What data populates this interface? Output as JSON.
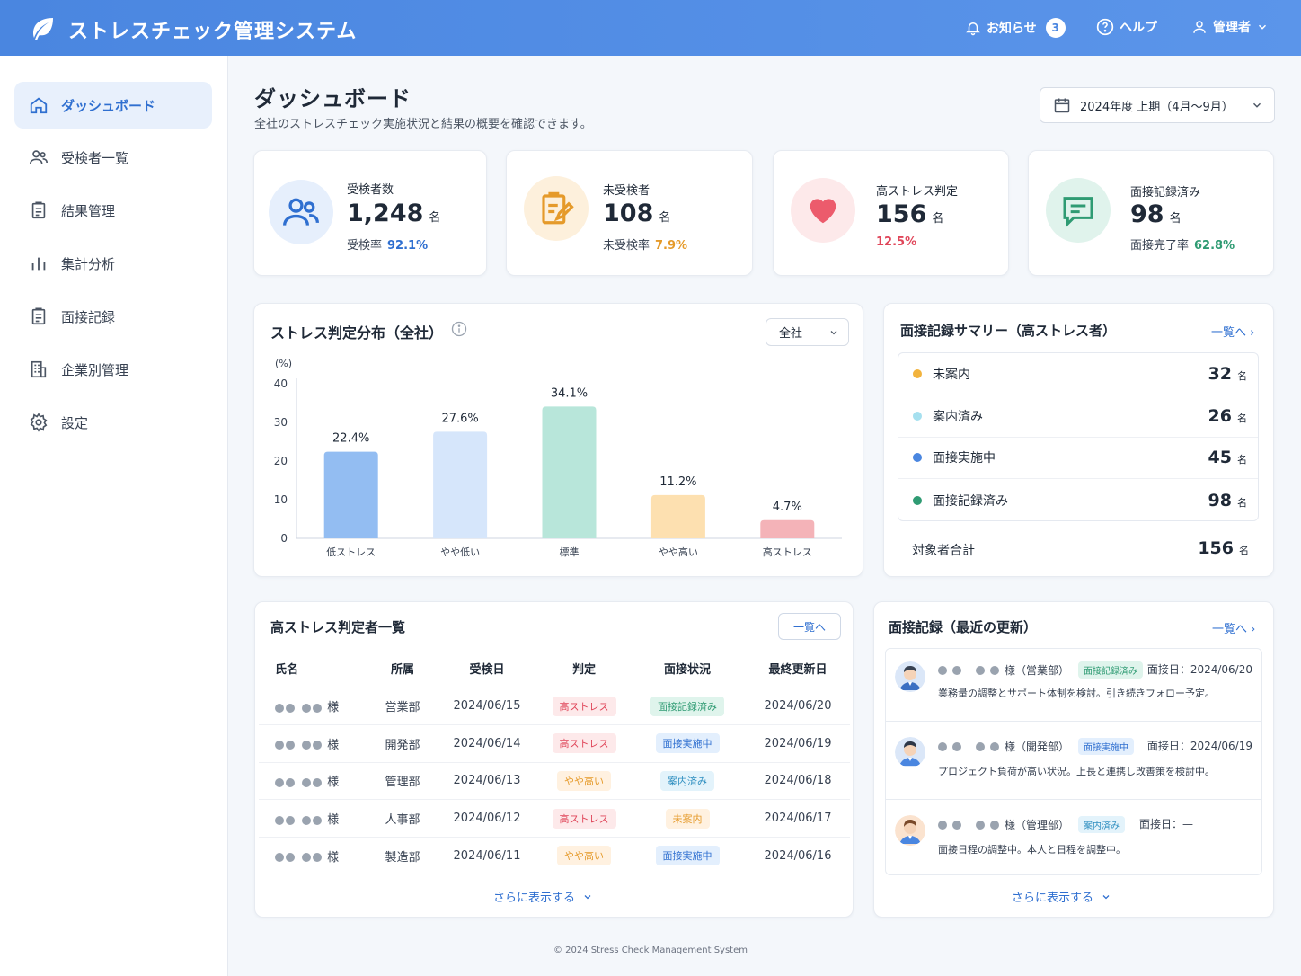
{
  "header": {
    "app_title": "ストレスチェック管理システム",
    "notifications_label": "お知らせ",
    "notifications_count": "3",
    "help_label": "ヘルプ",
    "user_label": "管理者"
  },
  "sidebar": {
    "items": [
      {
        "label": "ダッシュボード",
        "icon": "home-icon",
        "active": true
      },
      {
        "label": "受検者一覧",
        "icon": "users-icon",
        "active": false
      },
      {
        "label": "結果管理",
        "icon": "clipboard-icon",
        "active": false
      },
      {
        "label": "集計分析",
        "icon": "bar-chart-icon",
        "active": false
      },
      {
        "label": "面接記録",
        "icon": "clipboard-icon",
        "active": false
      },
      {
        "label": "企業別管理",
        "icon": "building-icon",
        "active": false
      },
      {
        "label": "設定",
        "icon": "gear-icon",
        "active": false
      }
    ]
  },
  "page": {
    "title": "ダッシュボード",
    "description": "全社のストレスチェック実施状況と結果の概要を確認できます。",
    "period": "2024年度 上期（4月〜9月）"
  },
  "kpis": [
    {
      "label": "受検者数",
      "value": "1,248",
      "unit": "名",
      "sub_label": "受検率",
      "sub_value": "92.1%",
      "color": "#2f6fd0"
    },
    {
      "label": "未受検者",
      "value": "108",
      "unit": "名",
      "sub_label": "未受検率",
      "sub_value": "7.9%",
      "color": "#e59a2a"
    },
    {
      "label": "高ストレス判定",
      "value": "156",
      "unit": "名",
      "sub_label": "",
      "sub_value": "12.5%",
      "color": "#e0465a"
    },
    {
      "label": "面接記録済み",
      "value": "98",
      "unit": "名",
      "sub_label": "面接完了率",
      "sub_value": "62.8%",
      "color": "#2f9b73"
    }
  ],
  "stress_chart": {
    "title": "ストレス判定分布（全社）",
    "filter": "全社"
  },
  "chart_data": {
    "type": "bar",
    "categories": [
      "低ストレス",
      "やや低い",
      "標準",
      "やや高い",
      "高ストレス"
    ],
    "values": [
      22.4,
      27.6,
      34.1,
      11.2,
      4.7
    ],
    "labels": [
      "22.4%",
      "27.6%",
      "34.1%",
      "11.2%",
      "4.7%"
    ],
    "colors": [
      "#93bdf2",
      "#d6e6fb",
      "#b8e6da",
      "#fde0b0",
      "#f4b3b8"
    ],
    "ylabel": "(%)",
    "yticks": [
      "0",
      "10",
      "20",
      "30",
      "40"
    ],
    "ylim": [
      0,
      40
    ]
  },
  "summary": {
    "title": "面接記録サマリー（高ストレス者）",
    "link": "一覧へ ›",
    "rows": [
      {
        "label": "未案内",
        "value": "32",
        "unit": "名",
        "color": "#f2b33d"
      },
      {
        "label": "案内済み",
        "value": "26",
        "unit": "名",
        "color": "#a6e0ef"
      },
      {
        "label": "面接実施中",
        "value": "45",
        "unit": "名",
        "color": "#4a86e0"
      },
      {
        "label": "面接記録済み",
        "value": "98",
        "unit": "名",
        "color": "#2f9b73"
      }
    ],
    "total_label": "対象者合計",
    "total_value": "156",
    "total_unit": "名"
  },
  "high_stress": {
    "title": "高ストレス判定者一覧",
    "link": "一覧へ",
    "columns": [
      "氏名",
      "所属",
      "受検日",
      "判定",
      "面接状況",
      "最終更新日"
    ],
    "rows": [
      {
        "name": "様",
        "dept": "営業部",
        "date": "2024/06/15",
        "judge": "高ストレス",
        "judge_type": "high",
        "status": "面接記録済み",
        "status_type": "done",
        "updated": "2024/06/20"
      },
      {
        "name": "様",
        "dept": "開発部",
        "date": "2024/06/14",
        "judge": "高ストレス",
        "judge_type": "high",
        "status": "面接実施中",
        "status_type": "prog",
        "updated": "2024/06/19"
      },
      {
        "name": "様",
        "dept": "管理部",
        "date": "2024/06/13",
        "judge": "やや高い",
        "judge_type": "mid",
        "status": "案内済み",
        "status_type": "info",
        "updated": "2024/06/18"
      },
      {
        "name": "様",
        "dept": "人事部",
        "date": "2024/06/12",
        "judge": "高ストレス",
        "judge_type": "high",
        "status": "未案内",
        "status_type": "not",
        "updated": "2024/06/17"
      },
      {
        "name": "様",
        "dept": "製造部",
        "date": "2024/06/11",
        "judge": "やや高い",
        "judge_type": "mid",
        "status": "面接実施中",
        "status_type": "prog",
        "updated": "2024/06/16"
      }
    ],
    "more": "さらに表示する"
  },
  "recent": {
    "title": "面接記録（最近の更新）",
    "link": "一覧へ ›",
    "items": [
      {
        "name": "様（営業部）",
        "tag": "面接記録済み",
        "tag_type": "done",
        "date": "面接日：2024/06/20",
        "text": "業務量の調整とサポート体制を検討。引き続きフォロー予定。"
      },
      {
        "name": "様（開発部）",
        "tag": "面接実施中",
        "tag_type": "prog",
        "date": "面接日：2024/06/19",
        "text": "プロジェクト負荷が高い状況。上長と連携し改善策を検討中。"
      },
      {
        "name": "様（管理部）",
        "tag": "案内済み",
        "tag_type": "info",
        "date": "面接日：—",
        "text": "面接日程の調整中。本人と日程を調整中。"
      }
    ],
    "more": "さらに表示する"
  },
  "footer": "© 2024 Stress Check Management System"
}
